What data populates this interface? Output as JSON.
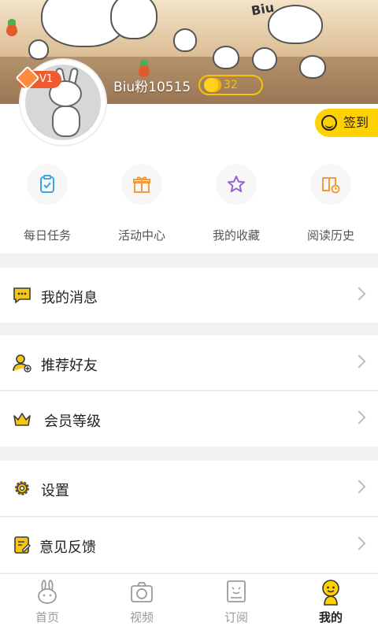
{
  "profile": {
    "level": "V1",
    "username": "Biu粉10515",
    "coins": "32",
    "checkin_label": "签到"
  },
  "banner": {
    "text": "Biu"
  },
  "actions": [
    {
      "label": "每日任务",
      "icon": "clipboard-check-icon"
    },
    {
      "label": "活动中心",
      "icon": "gift-icon"
    },
    {
      "label": "我的收藏",
      "icon": "star-icon"
    },
    {
      "label": "阅读历史",
      "icon": "book-clock-icon"
    }
  ],
  "menu": [
    {
      "label": "我的消息",
      "icon": "message-icon"
    },
    {
      "label": "推荐好友",
      "icon": "add-friend-icon"
    },
    {
      "label": "会员等级",
      "icon": "crown-icon"
    },
    {
      "label": "设置",
      "icon": "gear-icon"
    },
    {
      "label": "意见反馈",
      "icon": "feedback-icon"
    }
  ],
  "tabs": [
    {
      "label": "首页",
      "icon": "bunny-home-icon"
    },
    {
      "label": "视频",
      "icon": "camera-icon"
    },
    {
      "label": "订阅",
      "icon": "subscribe-icon"
    },
    {
      "label": "我的",
      "icon": "me-icon",
      "active": true
    }
  ],
  "colors": {
    "accent_yellow": "#ffd100",
    "badge_orange": "#f15a2e",
    "coin_gold": "#f6c400",
    "action_blue": "#3aa6e0",
    "action_orange": "#f39a3c",
    "action_purple": "#9b5fd6"
  }
}
